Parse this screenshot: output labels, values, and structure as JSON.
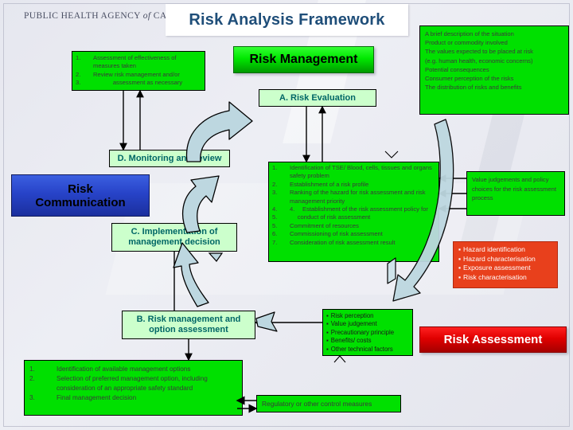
{
  "header": {
    "logo_text_main": "PUBLIC HEALTH AGENCY",
    "logo_text_italic": "of",
    "logo_text_tail": "CANADA",
    "title": "Risk Analysis Framework"
  },
  "colors": {
    "bright_green": "#00e000",
    "light_green": "#ccffcc",
    "blue": "#2743c8",
    "red": "#e00000",
    "red_orange": "#e8401c",
    "title_blue": "#1f4e79",
    "teal_text": "#006666",
    "arrow_fill": "#bdd7e0",
    "background": "#e8e9f0"
  },
  "monitoring_list": {
    "items": [
      {
        "num": "1.",
        "text": "Assessment of effectiveness of measures taken"
      },
      {
        "num": "2.",
        "text": "Review risk management and/or"
      },
      {
        "num": "3.",
        "text": "assessment as necessary"
      }
    ]
  },
  "situation_description": {
    "lines": [
      "A brief description of the situation",
      "Product or commodity involved",
      "The values expected to be placed at risk",
      "(e.g. human health, economic concerns)",
      "Potential consequences",
      "Consumer perception of the risks",
      "The distribution of risks and benefits"
    ]
  },
  "cycle": {
    "risk_management": "Risk Management",
    "risk_communication": "Risk\nCommunication",
    "risk_assessment": "Risk Assessment",
    "step_a": "A. Risk Evaluation",
    "step_b": "B. Risk management and option assessment",
    "step_c": "C. Implementation of management decision",
    "step_d": "D. Monitoring and review"
  },
  "evaluation_list": {
    "items": [
      {
        "num": "1.",
        "text": "Identification of TSE/ Blood, cells, tissues and organs safety problem"
      },
      {
        "num": "2.",
        "text": "Establishment of a risk profile"
      },
      {
        "num": "3.",
        "text": "Ranking of the hazard for risk assessment and risk management priority"
      },
      {
        "num": "4.",
        "text": "4.  Establishment of the risk assessment policy for"
      },
      {
        "num": "5.",
        "text": "  conduct of risk assessment"
      },
      {
        "num": "5.",
        "text": "Commitment of resources"
      },
      {
        "num": "6.",
        "text": "Commissioning of risk assessment"
      },
      {
        "num": "7.",
        "text": "Consideration of risk assessment result"
      }
    ]
  },
  "management_list": {
    "items": [
      {
        "num": "1.",
        "text": "Identification of available management options"
      },
      {
        "num": "2.",
        "text": "Selection of preferred management option, including consideration of an appropriate safety standard"
      },
      {
        "num": "3.",
        "text": "Final management decision"
      }
    ]
  },
  "policy_box": {
    "text": "Value judgements and policy choices for the risk assessment process"
  },
  "assessment_steps": {
    "bullets": [
      "Hazard identification",
      "Hazard characterisation",
      "Exposure assessment",
      "Risk characterisation"
    ]
  },
  "factors_box": {
    "bullets": [
      "Risk perception",
      "Value judgement",
      "Precautionary principle",
      "Benefits/ costs",
      "Other technical factors"
    ]
  },
  "regulatory_box": {
    "text": "Regulatory or other control measures"
  }
}
